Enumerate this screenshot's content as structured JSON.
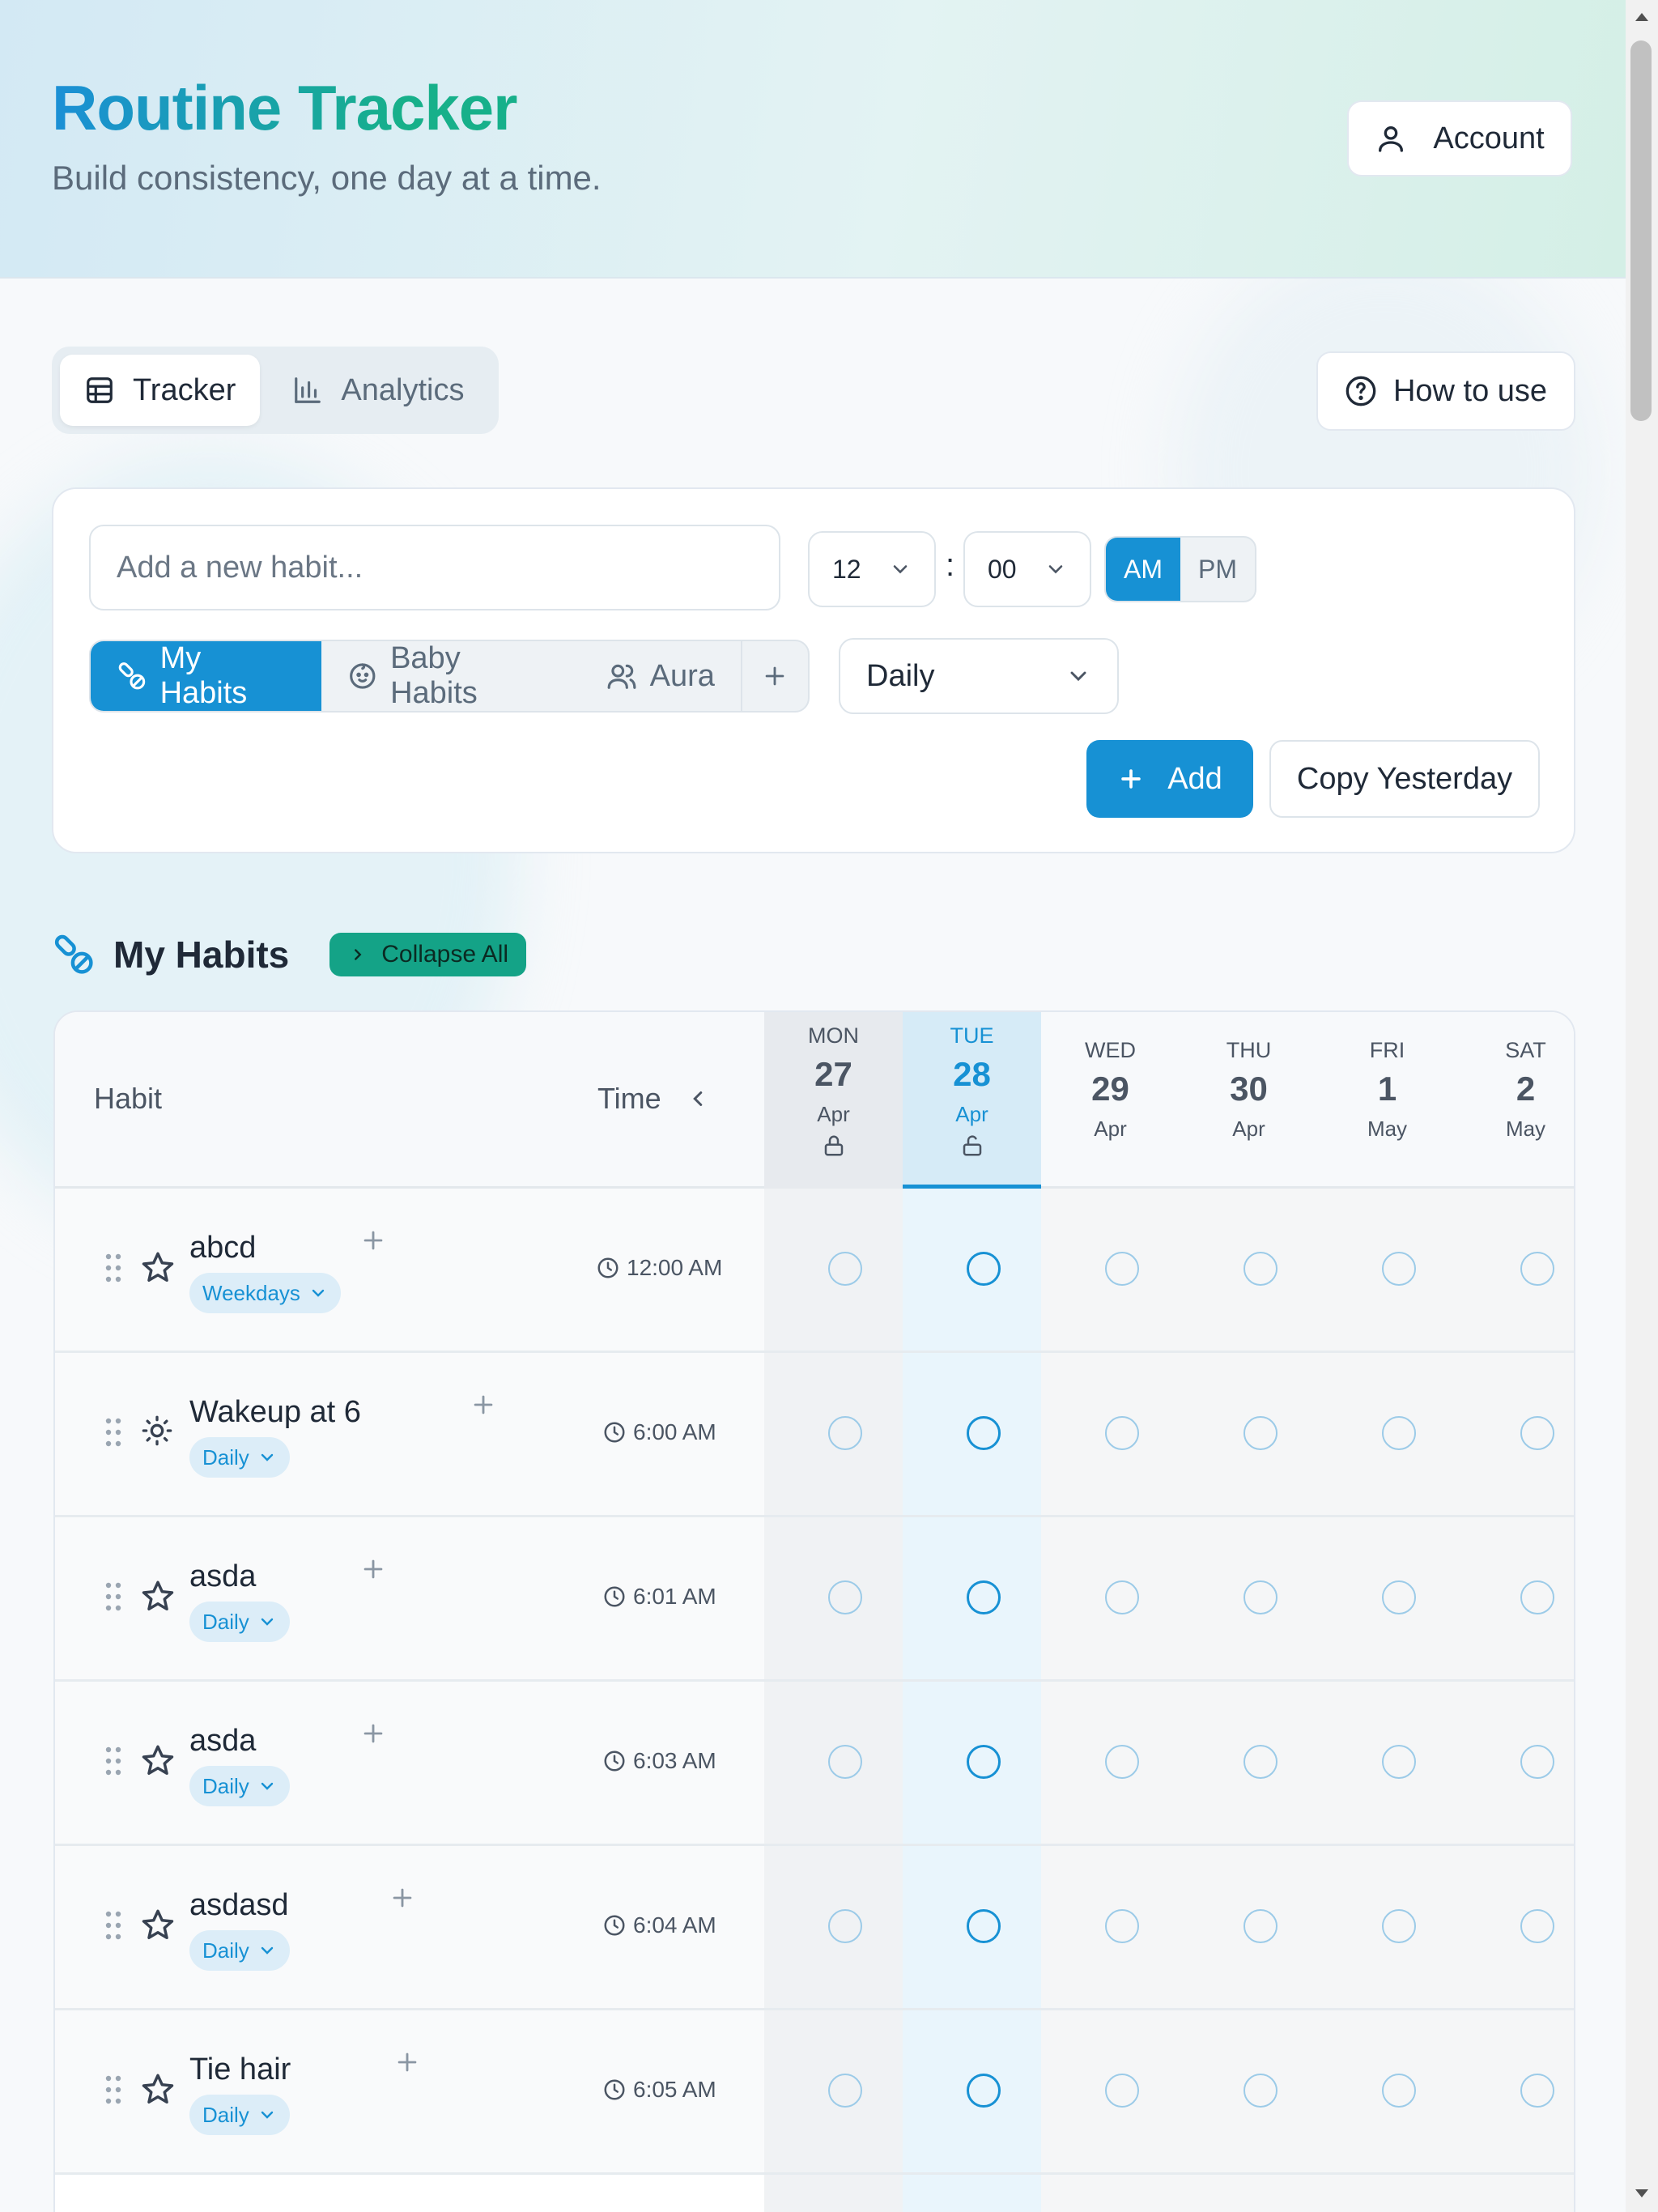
{
  "header": {
    "title": "Routine Tracker",
    "subtitle": "Build consistency, one day at a time.",
    "account_label": "Account"
  },
  "mode_tabs": [
    {
      "label": "Tracker",
      "icon": "table-icon",
      "active": true
    },
    {
      "label": "Analytics",
      "icon": "bar-chart-icon",
      "active": false
    }
  ],
  "how_to_label": "How to use",
  "add_form": {
    "placeholder": "Add a new habit...",
    "hour": "12",
    "minute": "00",
    "am_label": "AM",
    "pm_label": "PM",
    "selected_period": "AM",
    "categories": [
      {
        "label": "My Habits",
        "icon": "pills-icon",
        "active": true
      },
      {
        "label": "Baby Habits",
        "icon": "baby-face-icon",
        "active": false
      },
      {
        "label": "Aura",
        "icon": "users-icon",
        "active": false
      }
    ],
    "frequency": "Daily",
    "add_label": "Add",
    "copy_label": "Copy Yesterday"
  },
  "section": {
    "title": "My Habits",
    "collapse_label": "Collapse All"
  },
  "table": {
    "habit_header": "Habit",
    "time_header": "Time",
    "days": [
      {
        "dow": "MON",
        "num": "27",
        "mon": "Apr",
        "state": "past"
      },
      {
        "dow": "TUE",
        "num": "28",
        "mon": "Apr",
        "state": "today"
      },
      {
        "dow": "WED",
        "num": "29",
        "mon": "Apr",
        "state": "future"
      },
      {
        "dow": "THU",
        "num": "30",
        "mon": "Apr",
        "state": "future"
      },
      {
        "dow": "FRI",
        "num": "1",
        "mon": "May",
        "state": "future"
      },
      {
        "dow": "SAT",
        "num": "2",
        "mon": "May",
        "state": "future"
      }
    ],
    "rows": [
      {
        "name": "abcd",
        "badge": "Weekdays",
        "time": "12:00 AM",
        "icon": "star-icon"
      },
      {
        "name": "Wakeup at 6",
        "badge": "Daily",
        "time": "6:00 AM",
        "icon": "sun-icon"
      },
      {
        "name": "asda",
        "badge": "Daily",
        "time": "6:01 AM",
        "icon": "star-icon"
      },
      {
        "name": "asda",
        "badge": "Daily",
        "time": "6:03 AM",
        "icon": "star-icon"
      },
      {
        "name": "asdasd",
        "badge": "Daily",
        "time": "6:04 AM",
        "icon": "star-icon"
      },
      {
        "name": "Tie hair",
        "badge": "Daily",
        "time": "6:05 AM",
        "icon": "star-icon"
      }
    ]
  },
  "colors": {
    "primary": "#1791d4",
    "accent": "#14a387",
    "title_start": "#1b8fd6",
    "title_end": "#17b08a"
  }
}
